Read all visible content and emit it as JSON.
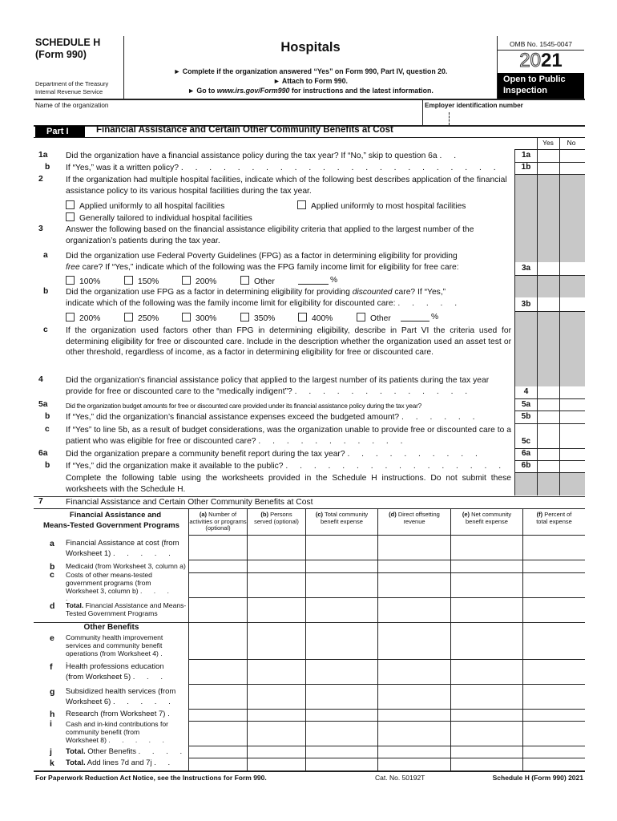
{
  "header": {
    "schedule": "SCHEDULE H",
    "form": "(Form 990)",
    "dept1": "Department of the Treasury",
    "dept2": "Internal Revenue Service",
    "title": "Hospitals",
    "instr1": "► Complete if the organization answered “Yes” on Form 990, Part IV, question 20.",
    "instr2": "► Attach to Form 990.",
    "instr3_pre": "► Go to ",
    "instr3_url": "www.irs.gov/Form990",
    "instr3_post": " for instructions and the latest information.",
    "omb": "OMB No. 1545-0047",
    "year_outline": "20",
    "year_bold": "21",
    "open1": "Open to Public",
    "open2": "Inspection",
    "name_label": "Name of the organization",
    "name_value": "",
    "ein_label": "Employer identification number",
    "ein_value": ""
  },
  "part1": {
    "part_label": "Part I",
    "title": "Financial Assistance and Certain Other Community Benefits at Cost",
    "yes": "Yes",
    "no": "No",
    "q1a_num": "1a",
    "q1a": "Did the organization have a financial assistance policy during the tax year? If “No,” skip to question 6a",
    "q1a_box": "1a",
    "q1b_num": "b",
    "q1b": "If “Yes,” was it a written policy?",
    "q1b_box": "1b",
    "q2_num": "2",
    "q2": "If the organization had multiple hospital facilities, indicate which of the following best describes application of the financial assistance policy to its various hospital facilities during the tax year.",
    "q2_opts": [
      "Applied uniformly to all hospital facilities",
      "Applied uniformly to most hospital facilities",
      "Generally tailored to individual hospital facilities"
    ],
    "q3_num": "3",
    "q3": "Answer the following based on the financial assistance eligibility criteria that applied to the largest number of the organization’s patients during the tax year.",
    "q3a_num": "a",
    "q3a_l1": "Did the organization use Federal Poverty Guidelines (FPG) as a factor in determining eligibility for providing",
    "q3a_l2_i": "free",
    "q3a_l2": " care? If “Yes,” indicate which of the following was the FPG family income limit for eligibility for free care:",
    "q3a_box": "3a",
    "q3a_opts": [
      "100%",
      "150%",
      "200%",
      "Other"
    ],
    "pct": "%",
    "q3b_num": "b",
    "q3b_l1_pre": "Did the organization use FPG as a factor in determining eligibility for providing ",
    "q3b_l1_i": "discounted",
    "q3b_l1_post": " care? If “Yes,”",
    "q3b_l2": "indicate which of the following was the family income limit for eligibility for discounted care:",
    "q3b_box": "3b",
    "q3b_opts": [
      "200%",
      "250%",
      "300%",
      "350%",
      "400%",
      "Other"
    ],
    "q3c_num": "c",
    "q3c": "If the organization used factors other than FPG in determining eligibility, describe in Part VI the criteria used for determining eligibility for free or discounted care. Include in the description whether the organization used an asset test or other threshold, regardless of income, as a factor in determining eligibility for free or discounted care.",
    "q4_num": "4",
    "q4": "Did the organization’s financial assistance policy that applied to the largest number of its patients during the tax year provide for free or discounted care to the “medically indigent”?",
    "q4_box": "4",
    "q5a_num": "5a",
    "q5a": "Did the organization budget amounts for free or discounted care provided under its financial assistance policy during the tax year?",
    "q5a_box": "5a",
    "q5b_num": "b",
    "q5b": "If “Yes,” did the organization’s financial assistance expenses exceed the budgeted amount?",
    "q5b_box": "5b",
    "q5c_num": "c",
    "q5c": "If “Yes” to line 5b, as a result of budget considerations, was the organization unable to provide free or discounted care to a patient who was eligible for free or discounted care?",
    "q5c_box": "5c",
    "q6a_num": "6a",
    "q6a": "Did the organization prepare a community benefit report during the tax year?",
    "q6a_box": "6a",
    "q6b_num": "b",
    "q6b": "If “Yes,” did the organization make it available to the public?",
    "q6b_box": "6b",
    "q6_note": "Complete the following table using the worksheets provided in the Schedule H instructions. Do not submit these worksheets with the Schedule H.",
    "q7_num": "7",
    "q7": "Financial Assistance and Certain Other Community Benefits at Cost"
  },
  "table7": {
    "section1_title_l1": "Financial Assistance and",
    "section1_title_l2": "Means-Tested Government Programs",
    "columns": [
      {
        "letter": "(a)",
        "label": "Number of activities or programs (optional)"
      },
      {
        "letter": "(b)",
        "label": "Persons served (optional)"
      },
      {
        "letter": "(c)",
        "label": "Total community benefit expense"
      },
      {
        "letter": "(d)",
        "label": "Direct offsetting revenue"
      },
      {
        "letter": "(e)",
        "label": "Net community benefit expense"
      },
      {
        "letter": "(f)",
        "label": "Percent of total expense"
      }
    ],
    "rows": [
      {
        "letter": "a",
        "label": "Financial Assistance at cost (from Worksheet 1)"
      },
      {
        "letter": "b",
        "label": "Medicaid (from Worksheet 3, column a)"
      },
      {
        "letter": "c",
        "label": "Costs of other means-tested government programs (from Worksheet 3, column b)"
      },
      {
        "letter": "d",
        "bold": "Total.",
        "label": " Financial Assistance and Means-Tested Government Programs"
      },
      {
        "letter": "e",
        "label": "Community health improvement services and community benefit operations (from Worksheet 4)"
      },
      {
        "letter": "f",
        "label": "Health professions education (from Worksheet 5)"
      },
      {
        "letter": "g",
        "label": "Subsidized health services (from Worksheet 6)"
      },
      {
        "letter": "h",
        "label": "Research (from Worksheet 7)"
      },
      {
        "letter": "i",
        "label": "Cash and in-kind contributions for community benefit (from Worksheet 8)"
      },
      {
        "letter": "j",
        "bold": "Total.",
        "label": " Other Benefits"
      },
      {
        "letter": "k",
        "bold": "Total.",
        "label": " Add lines 7d and 7j"
      }
    ],
    "section2_title": "Other Benefits"
  },
  "footer": {
    "paperwork": "For Paperwork Reduction Act Notice, see the Instructions for Form 990.",
    "cat": "Cat. No. 50192T",
    "form_ref": "Schedule H (Form 990) 2021"
  }
}
